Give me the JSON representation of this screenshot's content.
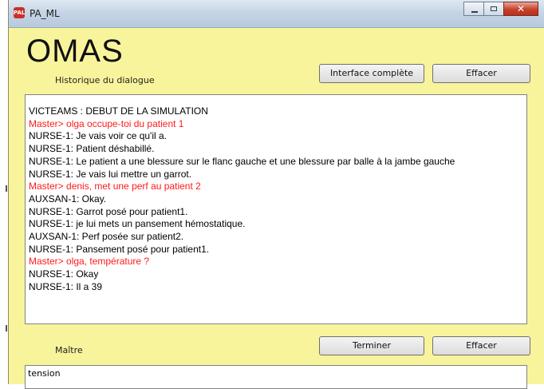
{
  "window": {
    "title": "PA_ML",
    "icon_text": "PAL"
  },
  "header": {
    "app_title": "OMAS"
  },
  "dialogue": {
    "label": "Historique du dialogue",
    "full_interface_button": "Interface complète",
    "clear_button": "Effacer",
    "lines": [
      {
        "text": "VICTEAMS : DEBUT DE LA SIMULATION",
        "speaker": "system"
      },
      {
        "text": "Master> olga occupe-toi du patient 1",
        "speaker": "master"
      },
      {
        "text": "NURSE-1: Je vais voir ce qu'il a.",
        "speaker": "agent"
      },
      {
        "text": "NURSE-1: Patient déshabillé.",
        "speaker": "agent"
      },
      {
        "text": "NURSE-1: Le patient a une blessure sur le flanc gauche et une blessure par balle à la jambe gauche",
        "speaker": "agent"
      },
      {
        "text": "NURSE-1: Je vais lui mettre un garrot.",
        "speaker": "agent"
      },
      {
        "text": "Master> denis, met une perf au patient 2",
        "speaker": "master"
      },
      {
        "text": "AUXSAN-1: Okay.",
        "speaker": "agent"
      },
      {
        "text": "NURSE-1: Garrot posé pour patient1.",
        "speaker": "agent"
      },
      {
        "text": "NURSE-1: je lui mets un pansement hémostatique.",
        "speaker": "agent"
      },
      {
        "text": "AUXSAN-1: Perf posée sur patient2.",
        "speaker": "agent"
      },
      {
        "text": "NURSE-1: Pansement posé pour patient1.",
        "speaker": "agent"
      },
      {
        "text": "Master> olga, température  ?",
        "speaker": "master"
      },
      {
        "text": "NURSE-1: Okay",
        "speaker": "agent"
      },
      {
        "text": "NURSE-1: Il a 39",
        "speaker": "agent"
      }
    ]
  },
  "master_input": {
    "label": "Maître",
    "terminate_button": "Terminer",
    "clear_button": "Effacer",
    "value": "tension"
  },
  "colors": {
    "background": "#f8f49c",
    "master_text": "#ff1a1a"
  }
}
